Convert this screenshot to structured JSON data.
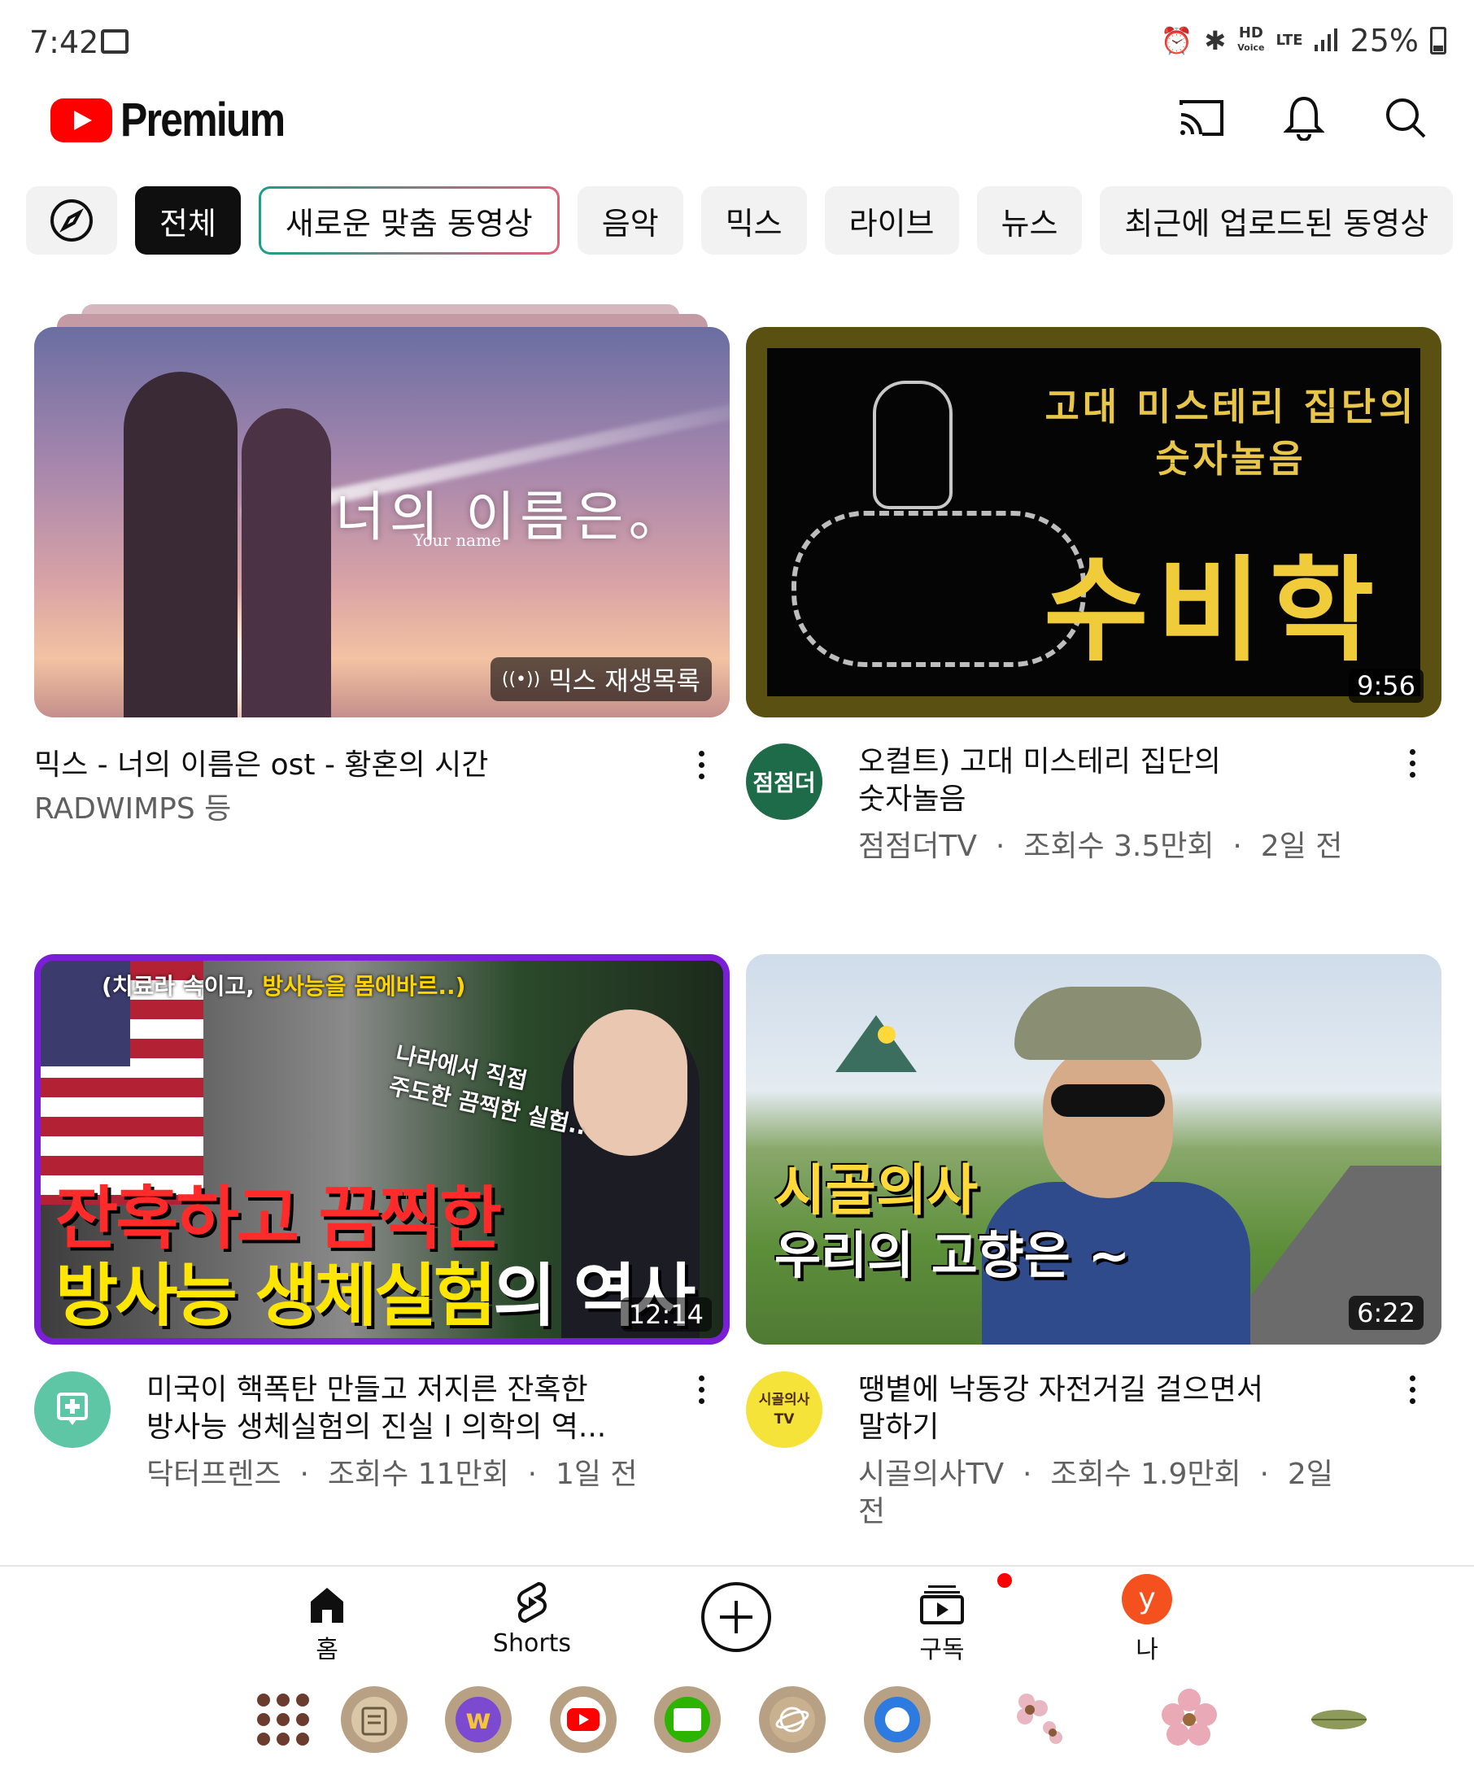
{
  "status_bar": {
    "time": "7:42",
    "battery": "25%",
    "hd": "HD",
    "voice": "Voice",
    "lte": "LTE"
  },
  "header": {
    "brand": "Premium"
  },
  "chips": [
    "전체",
    "새로운 맞춤 동영상",
    "음악",
    "믹스",
    "라이브",
    "뉴스",
    "최근에 업로드된 동영상"
  ],
  "videos": [
    {
      "thumb_title": "너의 이름은。",
      "thumb_subtitle": "Your name",
      "badge": "믹스 재생목록",
      "title": "믹스 - 너의 이름은 ost - 황혼의 시간",
      "channel": "RADWIMPS 등"
    },
    {
      "thumb_line1": "고대 미스테리 집단의",
      "thumb_line2": "숫자놀음",
      "thumb_big": "수비학",
      "duration": "9:56",
      "avatar_text": "점점더",
      "title_line1": "오컬트) 고대 미스테리 집단의",
      "title_line2": "숫자놀음",
      "channel": "점점더TV",
      "views": "조회수 3.5만회",
      "age": "2일 전"
    },
    {
      "thumb_top_a": "(치료라 속이고, ",
      "thumb_top_b": "방사능을 몸에바르..)",
      "thumb_mid1": "나라에서 직접",
      "thumb_mid2": "주도한 끔찍한 실험..",
      "thumb_red": "잔혹하고 끔찍한",
      "thumb_yellow_a": "방사능 생체실험",
      "thumb_yellow_b": "의 역사",
      "duration": "12:14",
      "title_line1": "미국이 핵폭탄 만들고 저지른 잔혹한",
      "title_line2": "방사능 생체실험의 진실 l 의학의 역...",
      "channel": "닥터프렌즈",
      "views": "조회수 11만회",
      "age": "1일 전"
    },
    {
      "thumb_c1": "시골의사",
      "thumb_c2": "우리의 고향은 ~",
      "duration": "6:22",
      "avatar_line1": "시골의사",
      "avatar_line2": "TV",
      "title_line1": "땡볕에 낙동강 자전거길 걸으면서",
      "title_line2": "말하기",
      "channel": "시골의사TV",
      "views": "조회수 1.9만회",
      "age_line1": "2일",
      "age_line2": "전"
    }
  ],
  "separator": "·",
  "nav": {
    "home": "홈",
    "shorts": "Shorts",
    "subscriptions": "구독",
    "me": "나",
    "avatar_letter": "y"
  },
  "colors": {
    "brand_red": "#FF0000",
    "avatar_orange": "#F4511E",
    "doctor_green": "#5EC6A5",
    "sigol_yellow": "#F5E33A",
    "jumjum_green": "#1E6B4A"
  }
}
